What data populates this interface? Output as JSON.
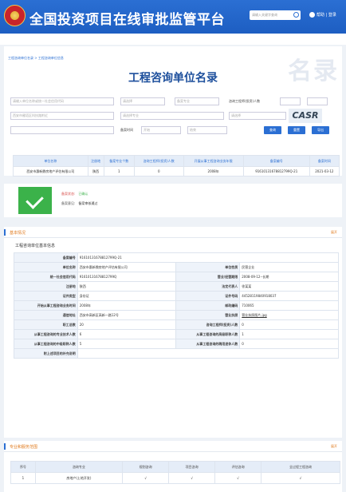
{
  "header": {
    "title": "全国投资项目在线审批监管平台",
    "search_placeholder": "请输入关键字查询",
    "help": "帮助 | 登录"
  },
  "page": {
    "breadcrumb": "工程咨询单位名录 > 工程咨询单位信息",
    "title": "工程咨询单位名录",
    "watermark": "名录"
  },
  "search_form": {
    "name_placeholder": "请输入单位名称或统一社会信用代码",
    "province_value": "请选择",
    "record_value": "备案专业",
    "staff_label": "咨询工程师(投资)人数",
    "region_placeholder": "西安市雁塔区科技路附近",
    "specialty_placeholder": "请选择专业",
    "other_placeholder": "请选择",
    "date_label": "备案时间",
    "date_start": "开始",
    "date_end": "结束",
    "query_button": "查询",
    "reset_button": "重置",
    "export_button": "导出",
    "captcha": "CASR"
  },
  "results": {
    "columns": [
      "单位名称",
      "注册地",
      "备案专业个数",
      "咨询工程师(投资)人数",
      "开展从事工程咨询业务年限",
      "备案编号",
      "备案时间"
    ],
    "rows": [
      [
        "西安市惠新鼎房地产评估有限公司",
        "陕西",
        "1",
        "0",
        "2008年",
        "91610131678812799Q-21",
        "2021-03-12"
      ]
    ]
  },
  "status": {
    "label1": "备案状态:",
    "value1": "已确认",
    "label2": "备案意见:",
    "value2": "备案审核通过"
  },
  "basic": {
    "section_title": "基本情况",
    "more": "展开",
    "subtitle": "工程咨询单位基本信息",
    "record_no_label": "备案编号",
    "record_no": "91610131678812799Q-21",
    "rows": [
      {
        "k1": "单位名称",
        "v1": "西安市惠新鼎房地产评估有限公司",
        "k2": "单位性质",
        "v2": "民营企业"
      },
      {
        "k1": "统一社会信用代码",
        "v1": "91610131678812799Q",
        "k2": "营业/经营期限",
        "v2": "2008-09-12--长期"
      },
      {
        "k1": "注册地",
        "v1": "陕西",
        "k2": "法定代表人",
        "v2": "徐某某"
      },
      {
        "k1": "证件类型",
        "v1": "身份证",
        "k2": "证件号码",
        "v2": "44528119840918037"
      },
      {
        "k1": "开始从事工程咨询业务时间",
        "v1": "2008年",
        "k2": "邮政编码",
        "v2": "710065"
      },
      {
        "k1": "通信地址",
        "v1": "西安市高新区高新一路12号",
        "k2": "营业执照",
        "v2": "营业执照图片.jpg"
      },
      {
        "k1": "职工总数",
        "v1": "20",
        "k2": "咨询工程师(投资)人数",
        "v2": "0"
      },
      {
        "k1": "从事工程咨询的专业技术人数",
        "v1": "6",
        "k2": "从事工程咨询的高级职称人数",
        "v2": "1"
      },
      {
        "k1": "从事工程咨询的中级职称人数",
        "v1": "5",
        "k2": "从事工程咨询的聘用退休人数",
        "v2": "0"
      }
    ],
    "last_label": "附上述项目的补充说明"
  },
  "scope": {
    "section_title": "专业和服务范围",
    "more": "展开",
    "columns": [
      "序号",
      "咨询专业",
      "规划咨询",
      "项目咨询",
      "评估咨询",
      "全过程工程咨询"
    ],
    "rows": [
      [
        "1",
        "房地产(土地开发)",
        "√",
        "√",
        "√",
        "√"
      ]
    ]
  }
}
